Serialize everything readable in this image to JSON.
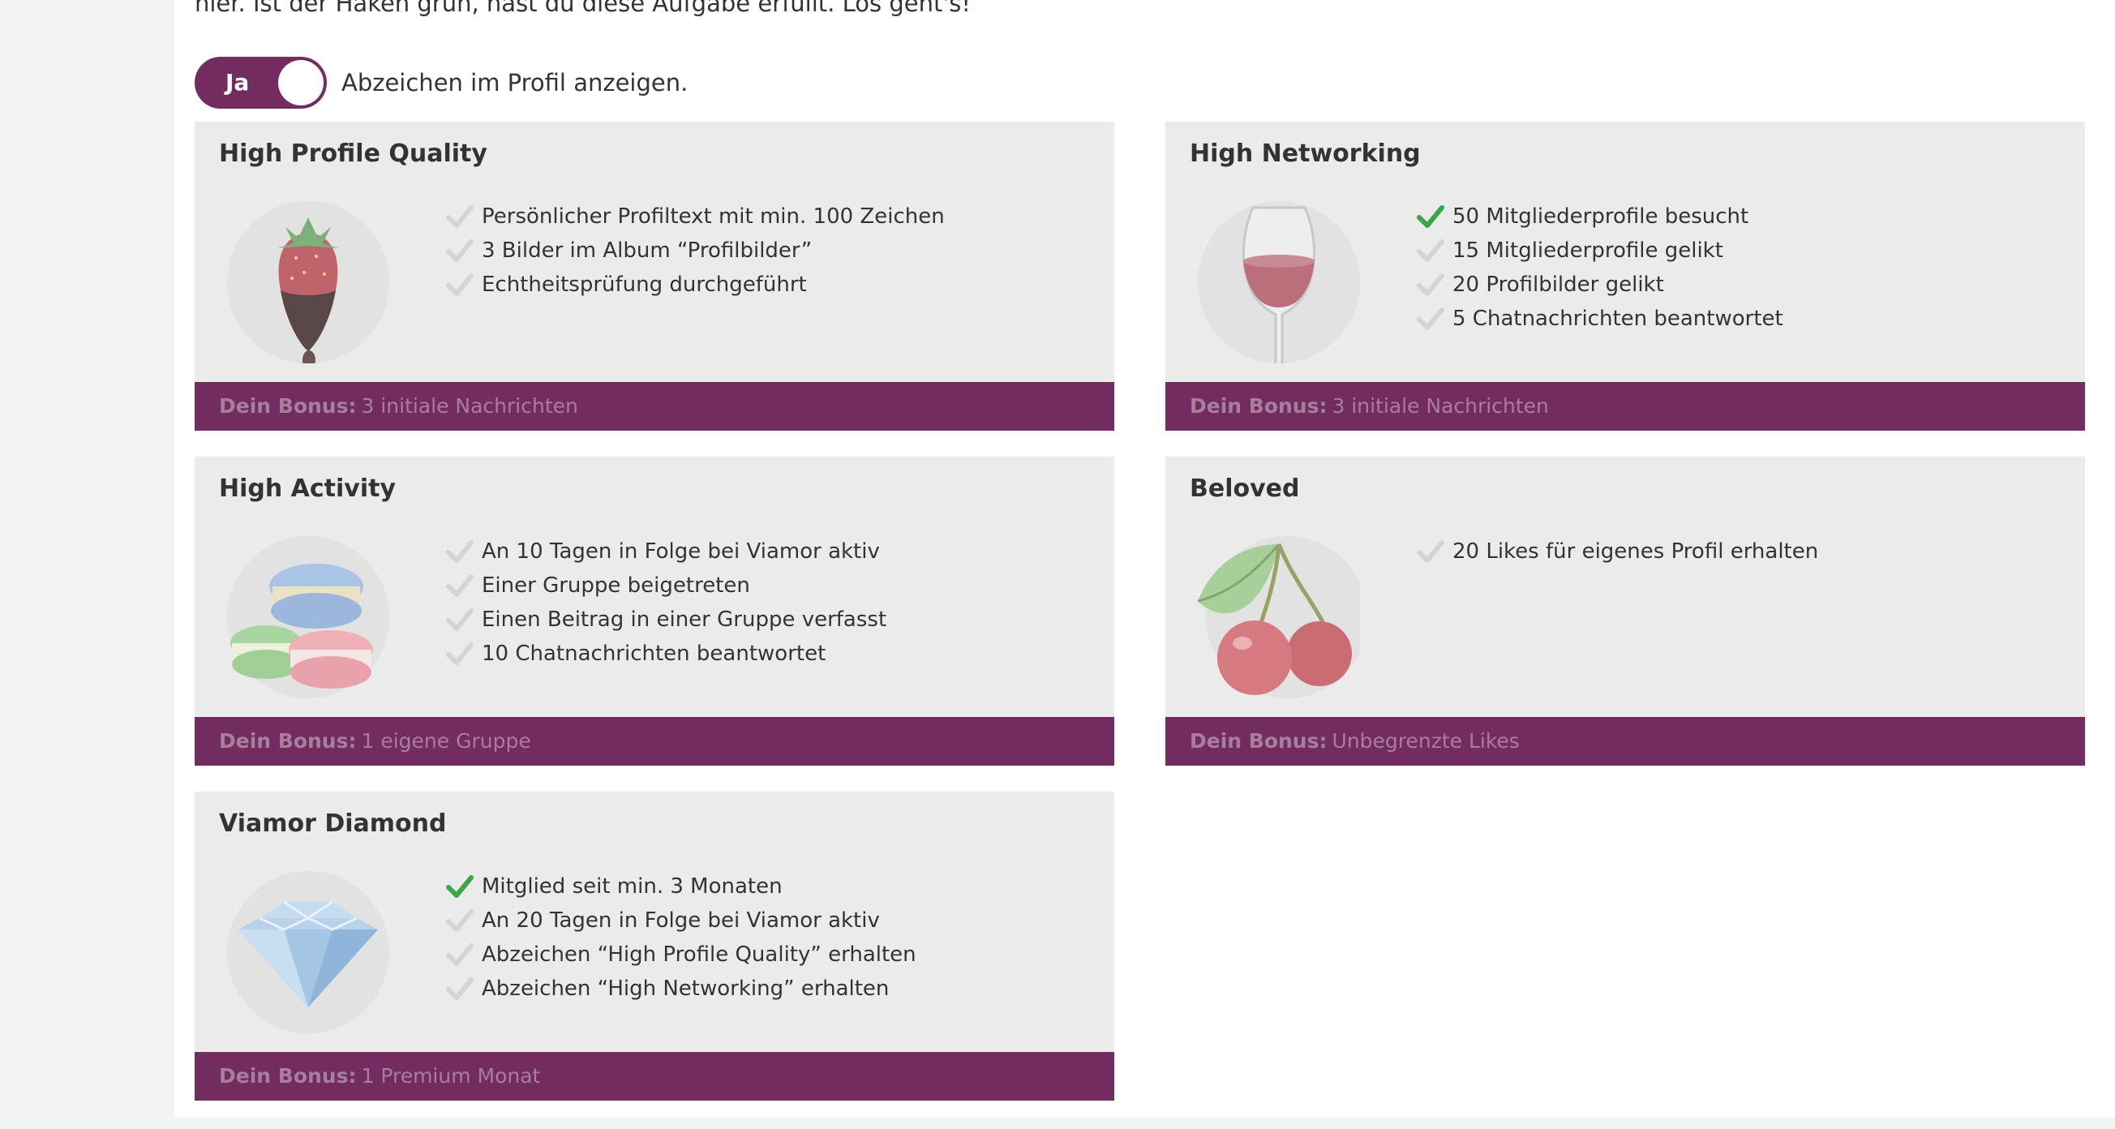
{
  "intro_text": "hier. Ist der Haken grün, hast du diese Aufgabe erfüllt. Los geht's!",
  "toggle": {
    "label": "Ja",
    "text": "Abzeichen im Profil anzeigen.",
    "on": true
  },
  "bonus_prefix": "Dein Bonus:",
  "colors": {
    "brand": "#722c60",
    "card_bg": "#ebebec",
    "check_done": "#3aa648",
    "check_pending": "#d4d4d5"
  },
  "badges": [
    {
      "title": "High Profile Quality",
      "icon": "strawberry-icon",
      "criteria": [
        {
          "text": "Persönlicher Profiltext mit min. 100 Zeichen",
          "done": false
        },
        {
          "text": "3 Bilder im Album “Profilbilder”",
          "done": false
        },
        {
          "text": "Echtheitsprüfung durchgeführt",
          "done": false
        }
      ],
      "bonus": "3 initiale Nachrichten"
    },
    {
      "title": "High Networking",
      "icon": "wine-glass-icon",
      "criteria": [
        {
          "text": "50 Mitgliederprofile besucht",
          "done": true
        },
        {
          "text": "15 Mitgliederprofile gelikt",
          "done": false
        },
        {
          "text": "20 Profilbilder gelikt",
          "done": false
        },
        {
          "text": "5 Chatnachrichten beantwortet",
          "done": false
        }
      ],
      "bonus": "3 initiale Nachrichten"
    },
    {
      "title": "High Activity",
      "icon": "macarons-icon",
      "criteria": [
        {
          "text": "An 10 Tagen in Folge bei Viamor aktiv",
          "done": false
        },
        {
          "text": "Einer Gruppe beigetreten",
          "done": false
        },
        {
          "text": "Einen Beitrag in einer Gruppe verfasst",
          "done": false
        },
        {
          "text": "10 Chatnachrichten beantwortet",
          "done": false
        }
      ],
      "bonus": "1 eigene Gruppe"
    },
    {
      "title": "Beloved",
      "icon": "cherries-icon",
      "criteria": [
        {
          "text": "20 Likes für eigenes Profil erhalten",
          "done": false
        }
      ],
      "bonus": "Unbegrenzte Likes"
    },
    {
      "title": "Viamor Diamond",
      "icon": "diamond-icon",
      "criteria": [
        {
          "text": "Mitglied seit min. 3 Monaten",
          "done": true
        },
        {
          "text": "An 20 Tagen in Folge bei Viamor aktiv",
          "done": false
        },
        {
          "text": "Abzeichen “High Profile Quality” erhalten",
          "done": false
        },
        {
          "text": "Abzeichen “High Networking” erhalten",
          "done": false
        }
      ],
      "bonus": "1 Premium Monat"
    }
  ]
}
